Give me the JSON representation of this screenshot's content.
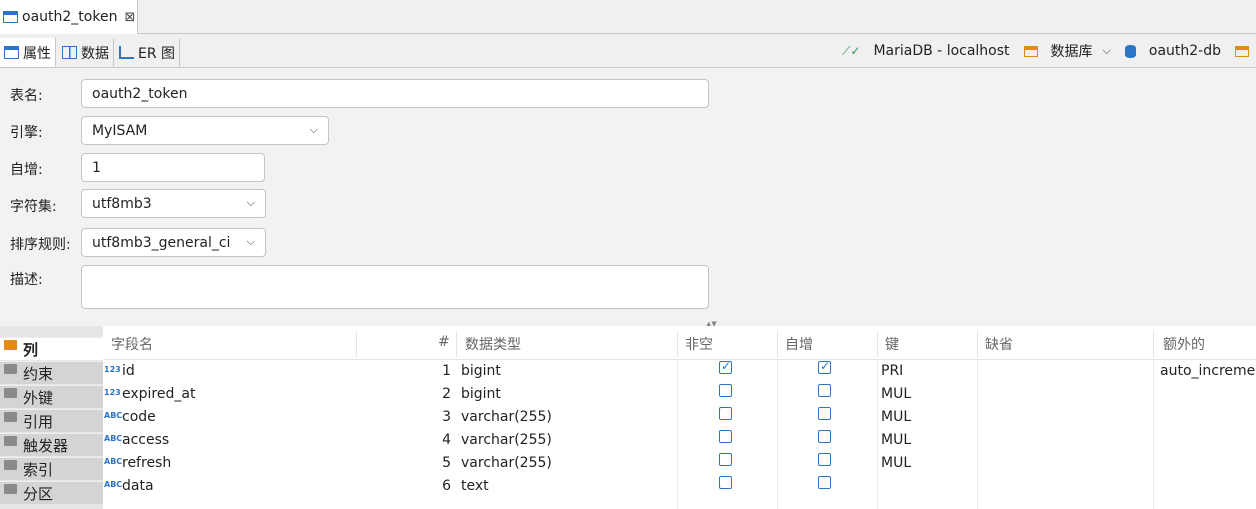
{
  "editor_tab": {
    "title": "oauth2_token",
    "close": "⊠"
  },
  "subtabs": [
    {
      "label": "属性"
    },
    {
      "label": "数据"
    },
    {
      "label": "ER 图"
    }
  ],
  "breadcrumb": {
    "connection": "MariaDB - localhost",
    "databases": "数据库",
    "database": "oauth2-db"
  },
  "form": {
    "table_name_label": "表名:",
    "table_name": "oauth2_token",
    "engine_label": "引擎:",
    "engine": "MyISAM",
    "auto_inc_label": "自增:",
    "auto_inc": "1",
    "charset_label": "字符集:",
    "charset": "utf8mb3",
    "collation_label": "排序规则:",
    "collation": "utf8mb3_general_ci",
    "desc_label": "描述:",
    "desc": ""
  },
  "side_tabs": [
    "列",
    "约束",
    "外键",
    "引用",
    "触发器",
    "索引",
    "分区"
  ],
  "columns_header": [
    "字段名",
    "#",
    "数据类型",
    "非空",
    "自增",
    "键",
    "缺省",
    "额外的"
  ],
  "rows": [
    {
      "type_icon": "123",
      "name": "id",
      "num": "1",
      "type": "bigint",
      "notnull": true,
      "autoinc": true,
      "key": "PRI",
      "default": "",
      "extra": "auto_increme"
    },
    {
      "type_icon": "123",
      "name": "expired_at",
      "num": "2",
      "type": "bigint",
      "notnull": false,
      "autoinc": false,
      "key": "MUL",
      "default": "",
      "extra": ""
    },
    {
      "type_icon": "ABC",
      "name": "code",
      "num": "3",
      "type": "varchar(255)",
      "notnull": false,
      "autoinc": false,
      "key": "MUL",
      "default": "",
      "extra": ""
    },
    {
      "type_icon": "ABC",
      "name": "access",
      "num": "4",
      "type": "varchar(255)",
      "notnull": false,
      "autoinc": false,
      "key": "MUL",
      "default": "",
      "extra": ""
    },
    {
      "type_icon": "ABC",
      "name": "refresh",
      "num": "5",
      "type": "varchar(255)",
      "notnull": false,
      "autoinc": false,
      "key": "MUL",
      "default": "",
      "extra": ""
    },
    {
      "type_icon": "ABC",
      "name": "data",
      "num": "6",
      "type": "text",
      "notnull": false,
      "autoinc": false,
      "key": "",
      "default": "",
      "extra": ""
    }
  ]
}
